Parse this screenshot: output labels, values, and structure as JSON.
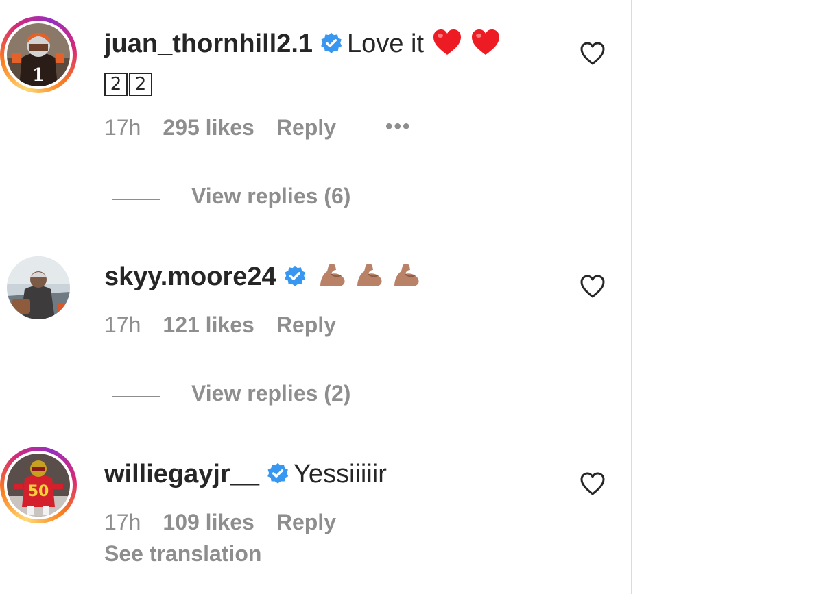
{
  "comments": [
    {
      "username": "juan_thornhill2.1",
      "verified": true,
      "text": "Love it",
      "emoji": [
        "heart",
        "heart"
      ],
      "second_line": [
        "2",
        "2"
      ],
      "time": "17h",
      "likes": "295 likes",
      "reply": "Reply",
      "more": "•••",
      "view_replies": "View replies (6)",
      "avatar_story_ring": true
    },
    {
      "username": "skyy.moore24",
      "verified": true,
      "text": "",
      "emoji": [
        "flexed-biceps",
        "flexed-biceps",
        "flexed-biceps"
      ],
      "time": "17h",
      "likes": "121 likes",
      "reply": "Reply",
      "view_replies": "View replies (2)",
      "avatar_story_ring": false
    },
    {
      "username": "williegayjr__",
      "verified": true,
      "text": "Yessiiiiir",
      "time": "17h",
      "likes": "109 likes",
      "reply": "Reply",
      "see_translation": "See translation",
      "avatar_story_ring": true
    }
  ],
  "colors": {
    "primary_text": "#262626",
    "secondary_text": "#8e8e8e",
    "verified_blue": "#3897f0",
    "heart_red": "#ed1c24",
    "divider": "#dbdbdb"
  },
  "icons": {
    "verified": "verified-badge-icon",
    "like": "heart-outline-icon",
    "more": "more-options-icon"
  }
}
